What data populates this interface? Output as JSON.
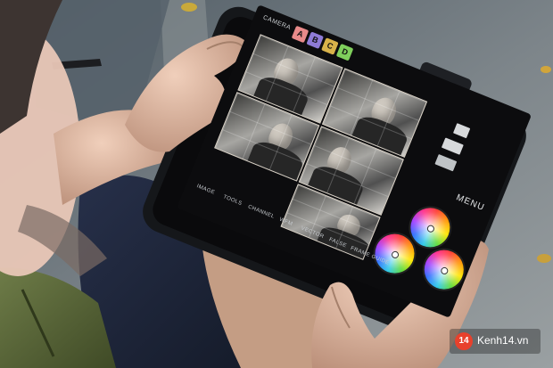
{
  "photo": {
    "description_free": true,
    "colors": {
      "ground": "#6c7378",
      "tablet_case": "#15171a",
      "jacket": "#5d6b3c",
      "jeans": "#1d2433",
      "skin": "#d9b29b"
    }
  },
  "screen": {
    "camera_label": "CAMERA",
    "camera_buttons": [
      {
        "label": "A",
        "color": "#e98a8a"
      },
      {
        "label": "B",
        "color": "#8e7bd6"
      },
      {
        "label": "C",
        "color": "#d8b24a"
      },
      {
        "label": "D",
        "color": "#7fcf5c"
      }
    ],
    "menu_label": "MENU",
    "toolbar": [
      "IMAGE",
      "TOOLS",
      "CHANNEL",
      "WFM",
      "VECTOR",
      "FALSE",
      "FRAME GUIDE"
    ],
    "wheel_icons": [
      "color-wheel-icon",
      "color-wheel-icon",
      "color-wheel-icon"
    ]
  },
  "watermark": {
    "badge": "14",
    "text": "Kenh14.vn"
  }
}
